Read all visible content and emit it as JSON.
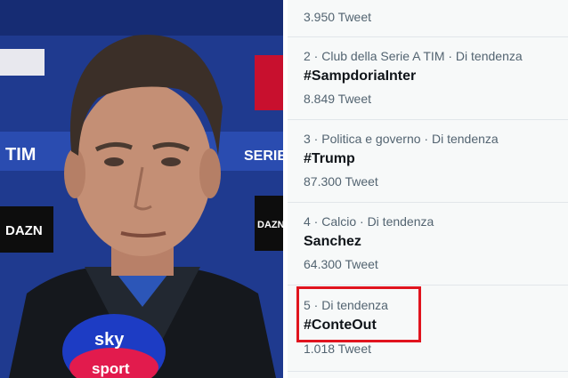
{
  "photo": {
    "banner_left": "TIM",
    "banner_right": "SERIE",
    "sponsor_left": "DAZN",
    "sponsor_right": "DAZN",
    "mic_brand_top": "sky",
    "mic_brand_bottom": "sport"
  },
  "trends": {
    "first_count": "3.950 Tweet",
    "items": [
      {
        "meta": "2 · Club della Serie A TIM · Di tendenza",
        "name": "#SampdoriaInter",
        "count": "8.849 Tweet"
      },
      {
        "meta": "3 · Politica e governo · Di tendenza",
        "name": "#Trump",
        "count": "87.300 Tweet"
      },
      {
        "meta": "4 · Calcio · Di tendenza",
        "name": "Sanchez",
        "count": "64.300 Tweet"
      },
      {
        "meta": "5 · Di tendenza",
        "name": "#ConteOut",
        "count": "1.018 Tweet"
      }
    ]
  },
  "colors": {
    "highlight": "#e0141e",
    "meta_text": "#536471",
    "title_text": "#0f1419"
  }
}
